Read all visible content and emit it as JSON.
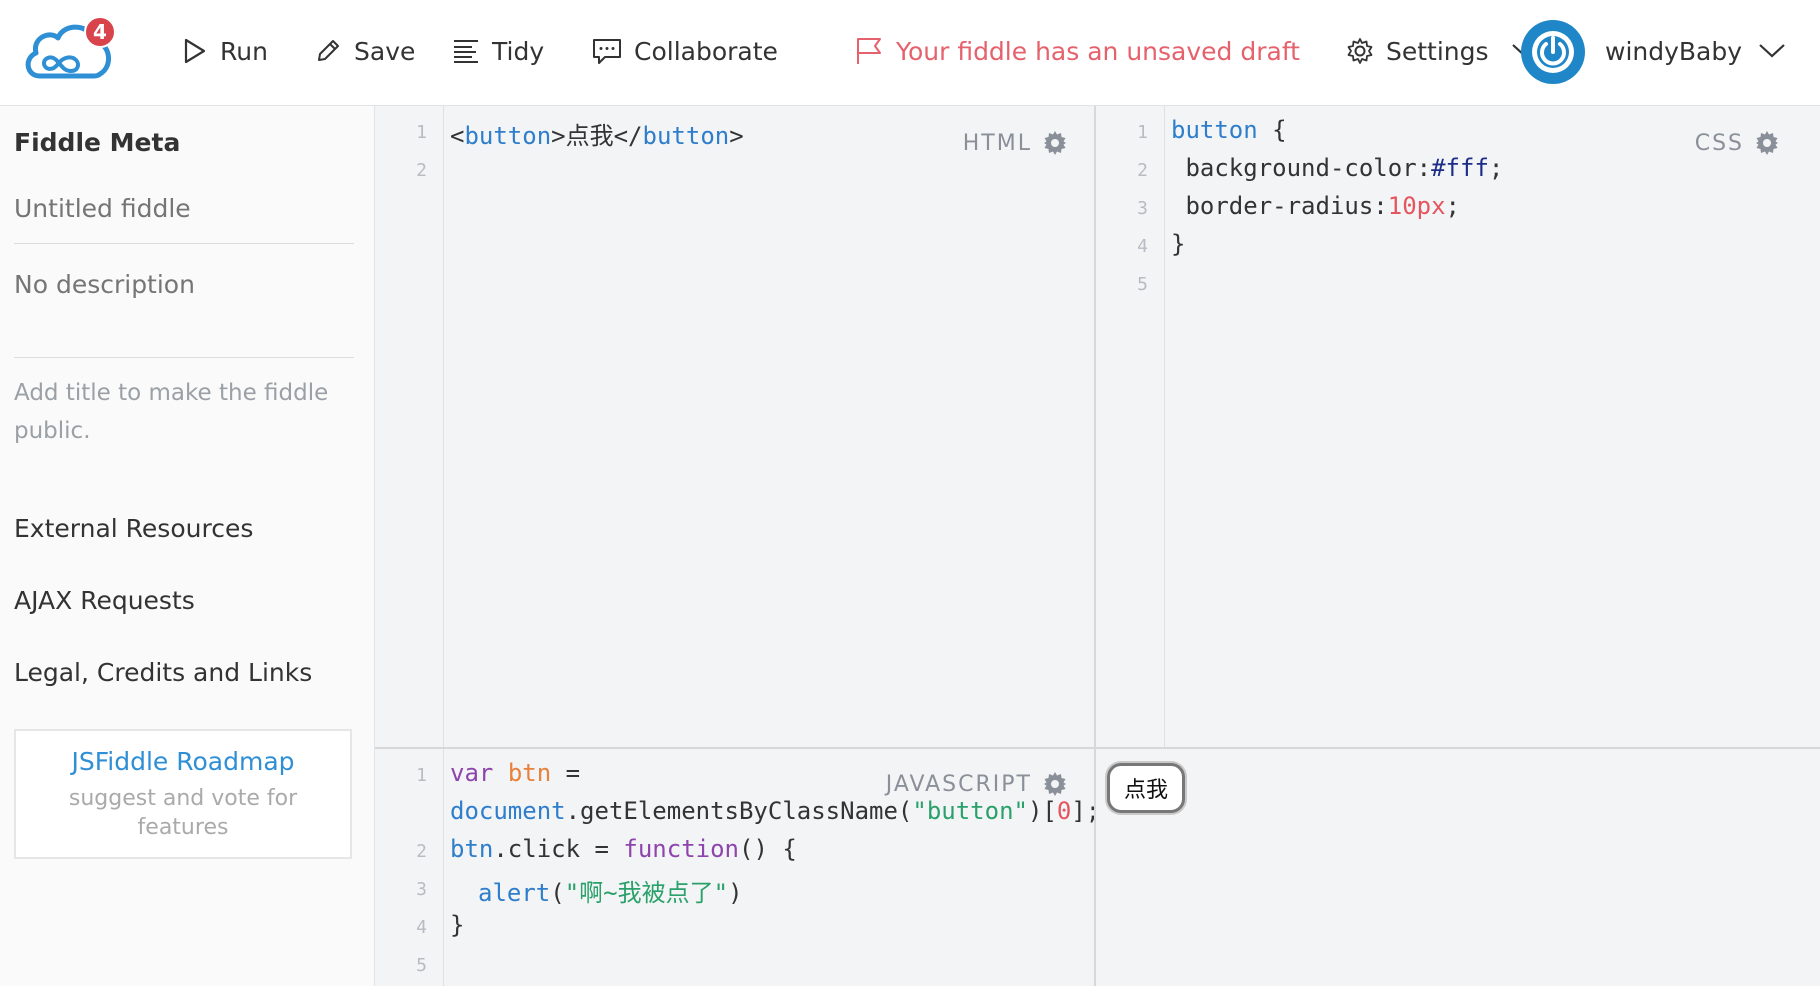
{
  "topbar": {
    "notifications": "4",
    "run": "Run",
    "save": "Save",
    "tidy": "Tidy",
    "collaborate": "Collaborate",
    "draft": "Your fiddle has an unsaved draft",
    "settings": "Settings",
    "username": "windyBaby"
  },
  "sidebar": {
    "title": "Fiddle Meta",
    "title_placeholder": "Untitled fiddle",
    "desc_placeholder": "No description",
    "note": "Add title to make the fiddle public.",
    "links": [
      "External Resources",
      "AJAX Requests",
      "Legal, Credits and Links"
    ],
    "roadmap_title": "JSFiddle Roadmap",
    "roadmap_sub": "suggest and vote for features"
  },
  "html_pane": {
    "label": "HTML",
    "line_numbers": [
      "1",
      "2"
    ],
    "code": {
      "open_lt": "<",
      "tag": "button",
      "gt1": ">",
      "text": "点我",
      "close_lt": "</",
      "tag2": "button",
      "gt2": ">"
    }
  },
  "css_pane": {
    "label": "CSS",
    "line_numbers": [
      "1",
      "2",
      "3",
      "4",
      "5"
    ],
    "lines": {
      "selector": "button",
      "brace_open": " {",
      "prop1": " background-color:",
      "val1": "#fff",
      "semi1": ";",
      "prop2": " border-radius:",
      "val2": "10px",
      "semi2": ";",
      "brace_close": "}"
    }
  },
  "js_pane": {
    "label": "JAVASCRIPT",
    "line_numbers": [
      "1",
      "2",
      "3",
      "4",
      "5"
    ],
    "tokens": {
      "var": "var",
      "btn": "btn",
      "eq": " =",
      "document": "document",
      "method": ".getElementsByClassName(",
      "arg": "\"button\"",
      "idx_open": ")[",
      "idx": "0",
      "idx_close": "];",
      "btn2": "btn",
      "click": ".click = ",
      "function": "function",
      "paren": "() {",
      "alert": "alert",
      "alert_open": "(",
      "msg": "\"啊~我被点了\"",
      "alert_close": ")",
      "brace_close": "}"
    }
  },
  "result": {
    "button_label": "点我"
  }
}
